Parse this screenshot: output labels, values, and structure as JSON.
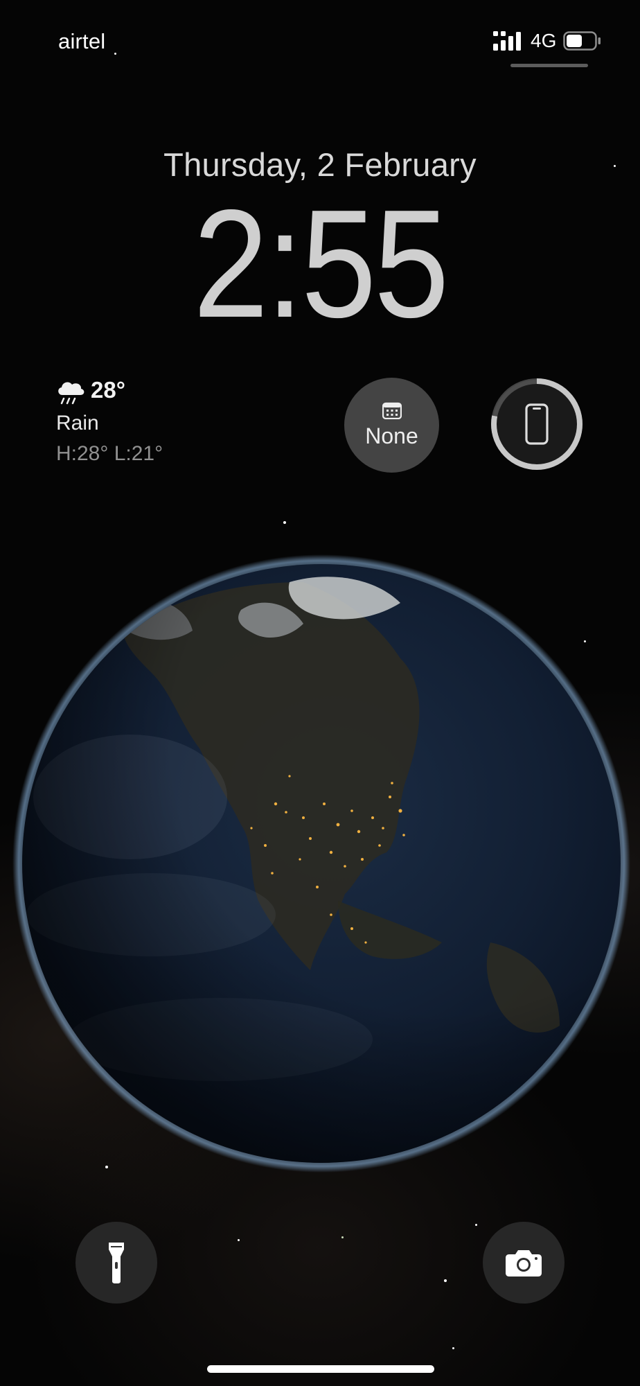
{
  "status_bar": {
    "carrier": "airtel",
    "network": "4G",
    "signal_icon": "signal-bars-icon",
    "battery_icon": "battery-icon",
    "battery_level": 0.55
  },
  "lock_screen": {
    "date": "Thursday, 2 February",
    "time": "2:55"
  },
  "weather": {
    "icon": "cloud-rain-icon",
    "temperature": "28°",
    "condition": "Rain",
    "high_low": "H:28° L:21°"
  },
  "widgets": {
    "calendar": {
      "icon": "calendar-icon",
      "label": "None"
    },
    "battery": {
      "icon": "phone-icon",
      "level": 0.78
    }
  },
  "controls": {
    "flashlight_icon": "flashlight-icon",
    "camera_icon": "camera-icon"
  },
  "colors": {
    "background": "#050505",
    "widget_bg": "#6e6e6e",
    "ring": "#c8c8c8"
  }
}
